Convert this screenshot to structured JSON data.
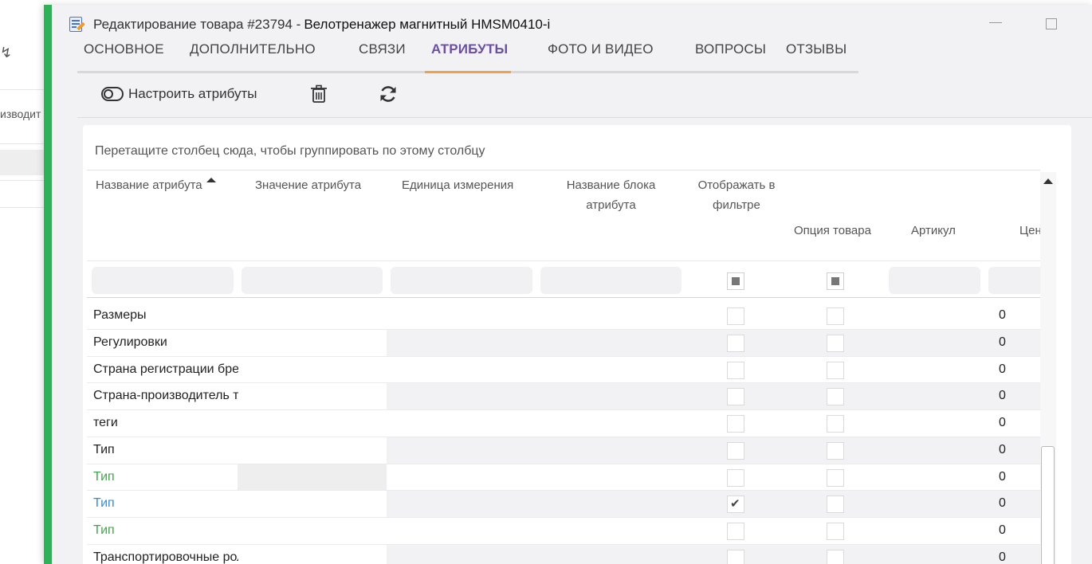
{
  "background": {
    "partial_text": "изводит"
  },
  "window": {
    "title_prefix": "Редактирование товара #23794 -",
    "title_product": "Велотренажер магнитный HMSM0410-i",
    "accent_color": "#2fb157"
  },
  "tabs": [
    {
      "label": "ОСНОВНОЕ",
      "active": false
    },
    {
      "label": "ДОПОЛНИТЕЛЬНО",
      "active": false
    },
    {
      "label": "СВЯЗИ",
      "active": false
    },
    {
      "label": "АТРИБУТЫ",
      "active": true
    },
    {
      "label": "ФОТО И ВИДЕО",
      "active": false
    },
    {
      "label": "ВОПРОСЫ",
      "active": false
    },
    {
      "label": "ОТЗЫВЫ",
      "active": false
    }
  ],
  "toolbar": {
    "configure_label": "Настроить атрибуты",
    "delete_icon": "trash-icon",
    "refresh_icon": "refresh-icon"
  },
  "grid": {
    "group_hint": "Перетащите столбец сюда, чтобы группировать по этому столбцу",
    "columns": {
      "name": "Название атрибута",
      "value": "Значение атрибута",
      "unit": "Единица измерения",
      "block_line1": "Название блока",
      "block_line2": "атрибута",
      "filter_line1": "Отображать в",
      "filter_line2": "фильтре",
      "option": "Опция товара",
      "sku": "Артикул",
      "price": "Цен"
    },
    "rows": [
      {
        "name": "Размеры",
        "color": "default",
        "filter": false,
        "option": false,
        "price": "0"
      },
      {
        "name": "Регулировки",
        "color": "default",
        "filter": false,
        "option": false,
        "price": "0"
      },
      {
        "name": "Страна регистрации бренда",
        "color": "default",
        "filter": false,
        "option": false,
        "price": "0"
      },
      {
        "name": "Страна-производитель товара",
        "color": "default",
        "filter": false,
        "option": false,
        "price": "0"
      },
      {
        "name": "теги",
        "color": "default",
        "filter": false,
        "option": false,
        "price": "0"
      },
      {
        "name": "Тип",
        "color": "default",
        "filter": false,
        "option": false,
        "price": "0"
      },
      {
        "name": "Тип",
        "color": "green",
        "filter": false,
        "option": false,
        "price": "0"
      },
      {
        "name": "Тип",
        "color": "blue",
        "filter": true,
        "option": false,
        "price": "0"
      },
      {
        "name": "Тип",
        "color": "green",
        "filter": false,
        "option": false,
        "price": "0"
      },
      {
        "name": "Транспортировочные ролики",
        "color": "default",
        "filter": false,
        "option": false,
        "price": "0"
      }
    ]
  }
}
